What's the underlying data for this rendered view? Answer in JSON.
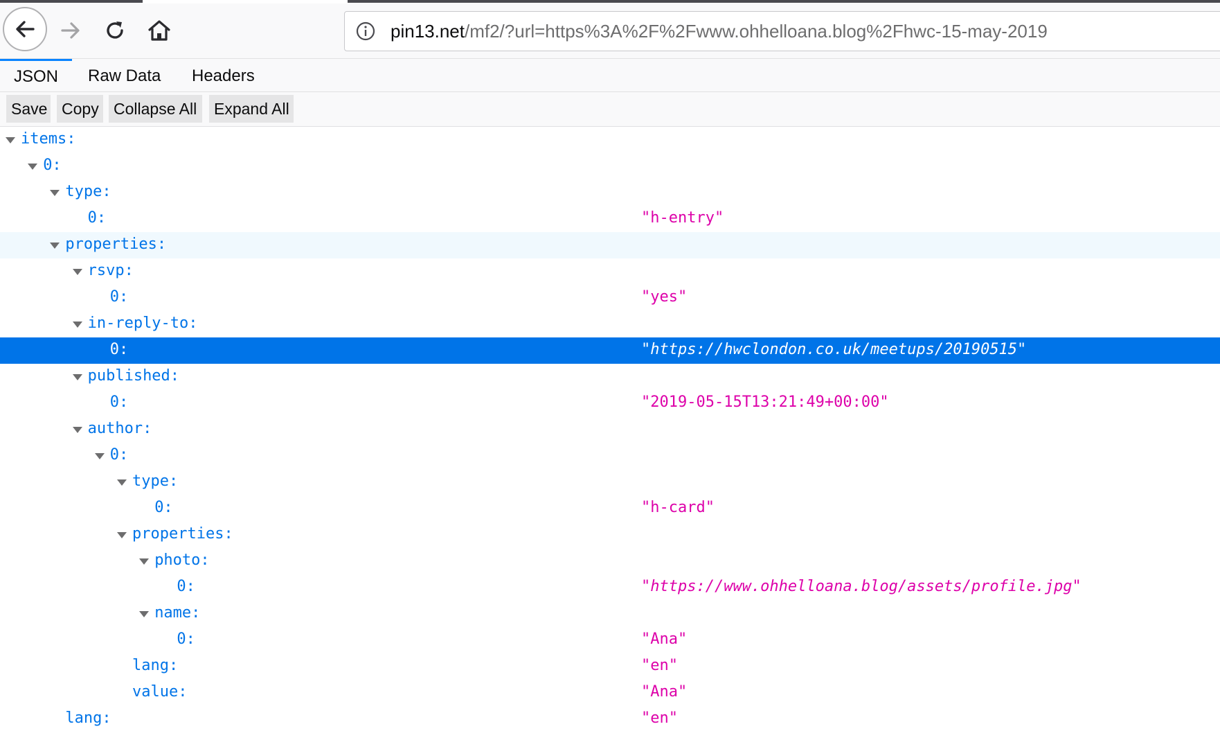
{
  "browser": {
    "url_host": "pin13.net",
    "url_rest": "/mf2/?url=https%3A%2F%2Fwww.ohhelloana.blog%2Fhwc-15-may-2019",
    "icons": [
      "back-arrow-icon",
      "forward-arrow-icon",
      "reload-icon",
      "home-icon",
      "info-icon"
    ]
  },
  "tabs": [
    {
      "label": "JSON",
      "selected": true
    },
    {
      "label": "Raw Data",
      "selected": false
    },
    {
      "label": "Headers",
      "selected": false
    }
  ],
  "toolbar": {
    "save": "Save",
    "copy": "Copy",
    "collapse_all": "Collapse All",
    "expand_all": "Expand All"
  },
  "tree": [
    {
      "key": "items:",
      "depth": 0,
      "expanded": true
    },
    {
      "key": "0:",
      "depth": 1,
      "expanded": true
    },
    {
      "key": "type:",
      "depth": 2,
      "expanded": true
    },
    {
      "key": "0:",
      "depth": 3,
      "value": "\"h-entry\""
    },
    {
      "key": "properties:",
      "depth": 2,
      "expanded": true,
      "hover": true
    },
    {
      "key": "rsvp:",
      "depth": 3,
      "expanded": true
    },
    {
      "key": "0:",
      "depth": 4,
      "value": "\"yes\""
    },
    {
      "key": "in-reply-to:",
      "depth": 3,
      "expanded": true
    },
    {
      "key": "0:",
      "depth": 4,
      "value": "\"https://hwclondon.co.uk/meetups/20190515\"",
      "url": true,
      "selected": true
    },
    {
      "key": "published:",
      "depth": 3,
      "expanded": true
    },
    {
      "key": "0:",
      "depth": 4,
      "value": "\"2019-05-15T13:21:49+00:00\""
    },
    {
      "key": "author:",
      "depth": 3,
      "expanded": true
    },
    {
      "key": "0:",
      "depth": 4,
      "expanded": true
    },
    {
      "key": "type:",
      "depth": 5,
      "expanded": true
    },
    {
      "key": "0:",
      "depth": 6,
      "value": "\"h-card\""
    },
    {
      "key": "properties:",
      "depth": 5,
      "expanded": true
    },
    {
      "key": "photo:",
      "depth": 6,
      "expanded": true
    },
    {
      "key": "0:",
      "depth": 7,
      "value": "\"https://www.ohhelloana.blog/assets/profile.jpg\"",
      "url": true
    },
    {
      "key": "name:",
      "depth": 6,
      "expanded": true
    },
    {
      "key": "0:",
      "depth": 7,
      "value": "\"Ana\""
    },
    {
      "key": "lang:",
      "depth": 5,
      "value": "\"en\""
    },
    {
      "key": "value:",
      "depth": 5,
      "value": "\"Ana\""
    },
    {
      "key": "lang:",
      "depth": 2,
      "value": "\"en\""
    }
  ],
  "colors": {
    "key": "#0074e8",
    "string": "#dd00a9",
    "selection": "#0074e8",
    "accent": "#0a84ff"
  }
}
